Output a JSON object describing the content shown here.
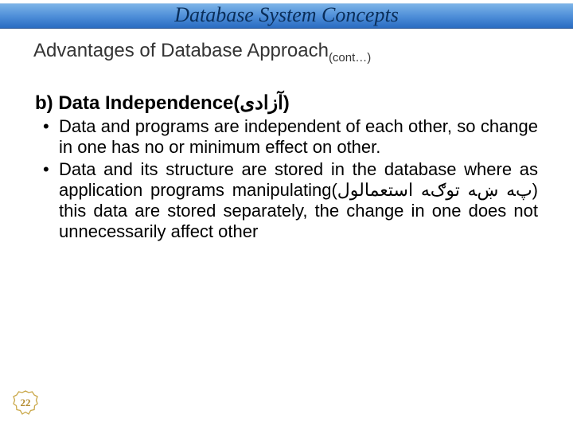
{
  "title": "Database System Concepts",
  "subtitle_main": "Advantages of Database Approach",
  "subtitle_sub": "(cont…)",
  "section": {
    "prefix": "b)",
    "heading_main": "Data Independence",
    "heading_paren": "(آزادی)"
  },
  "bullets": [
    "Data and programs are independent of each other, so change in one has no or minimum effect on other.",
    {
      "pre": "Data and its structure are stored in the database where as application programs manipulating",
      "paren": "(پﻪ ښﻪ ﺗﻮګﻪ ﺍﺳﺘﻌﻤﺎﻟﻮﻝ)",
      "post": " this data are stored separately, the change in one does not unnecessarily affect other"
    }
  ],
  "page_number": "22"
}
